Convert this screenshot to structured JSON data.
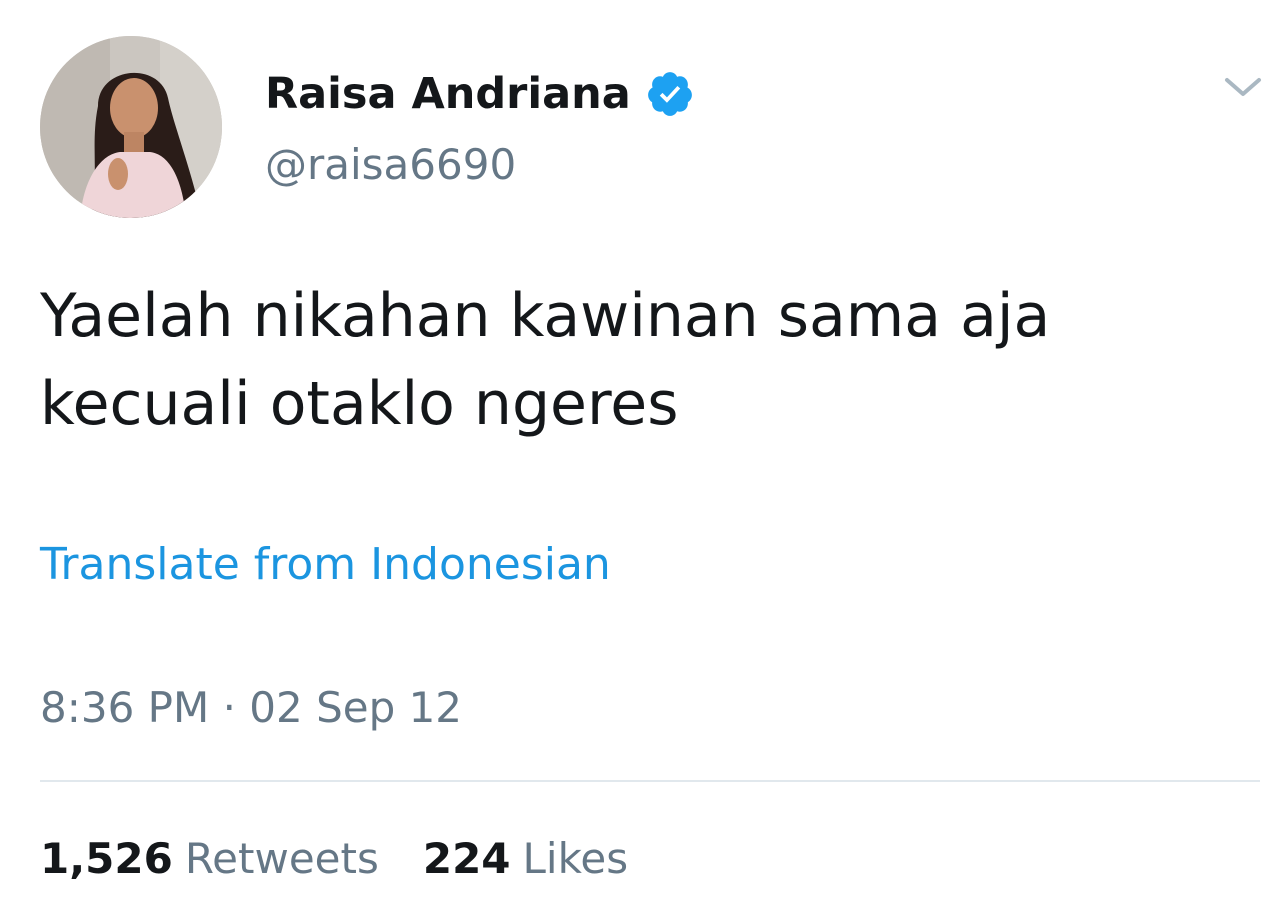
{
  "tweet": {
    "author": {
      "display_name": "Raisa Andriana",
      "handle": "@raisa6690",
      "verified": true
    },
    "text_lines": [
      "Yaelah nikahan kawinan sama aja",
      "kecuali otaklo ngeres"
    ],
    "translate_label": "Translate from Indonesian",
    "timestamp": "8:36 PM · 02 Sep 12",
    "stats": {
      "retweets_count": "1,526",
      "retweets_label": "Retweets",
      "likes_count": "224",
      "likes_label": "Likes"
    },
    "icons": {
      "verified": "verified-badge-icon",
      "menu": "chevron-down-icon"
    }
  },
  "colors": {
    "link": "#1b95e0",
    "secondary_text": "#657786",
    "primary_text": "#14171a",
    "divider": "#e1e8ed",
    "verified": "#1da1f2"
  }
}
